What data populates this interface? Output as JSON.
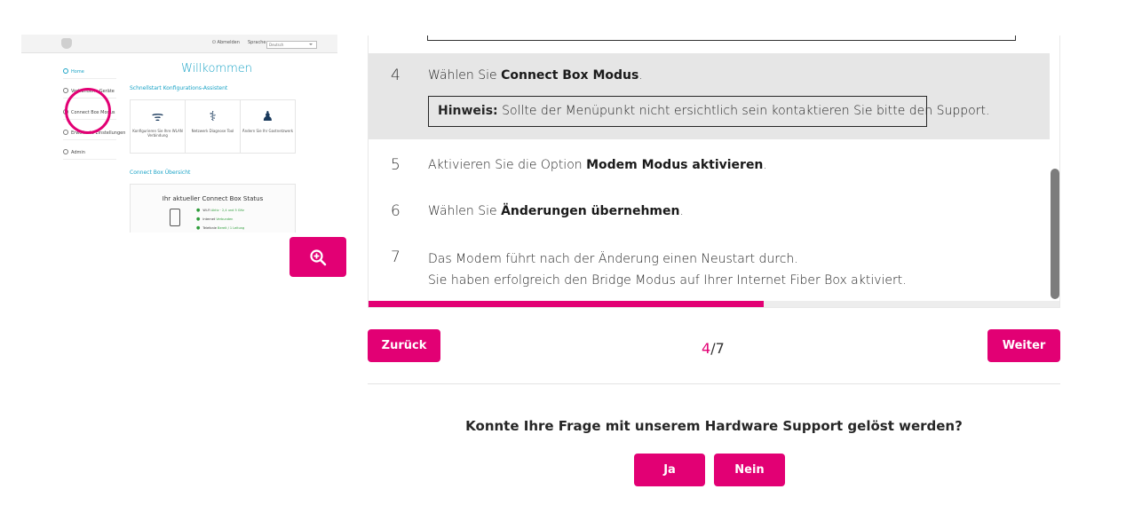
{
  "thumbnail": {
    "logout": "Abmelden",
    "language_label": "Sprache",
    "language_value": "Deutsch",
    "welcome": "Willkommen",
    "nav": [
      "Home",
      "Verbundene Geräte",
      "Connect Box Modus",
      "Erweiterte Einstellungen",
      "Admin"
    ],
    "quickstart": "Schnellstart Konfigurations-Assistent",
    "cards": [
      {
        "icon": "wifi-icon",
        "label": "Konfigurieren Sie Ihre WLAN Verbindung"
      },
      {
        "icon": "stethoscope-icon",
        "label": "Netzwerk Diagnose Tool"
      },
      {
        "icon": "guest-network-icon",
        "label": "Ändern Sie Ihr Gastnetzwerk"
      }
    ],
    "overview": "Connect Box Übersicht",
    "status_title": "Ihr aktueller Connect Box Status",
    "status_lines": [
      {
        "name": "Wi-Fi",
        "state": "Aktiv · 2,4 und 5 GHz"
      },
      {
        "name": "Internet",
        "state": "Verbunden"
      },
      {
        "name": "Telefonie",
        "state": "Bereit / 1 Leitung"
      }
    ]
  },
  "steps": [
    {
      "num": "4",
      "parts": [
        "Wählen Sie ",
        "Connect Box Modus",
        "."
      ],
      "hint_label": "Hinweis:",
      "hint_text": " Sollte der Menüpunkt nicht ersichtlich sein kontaktieren Sie bitte den Support."
    },
    {
      "num": "5",
      "parts": [
        "Aktivieren Sie die Option ",
        "Modem Modus aktivieren",
        "."
      ]
    },
    {
      "num": "6",
      "parts": [
        "Wählen Sie ",
        "Änderungen übernehmen",
        "."
      ]
    },
    {
      "num": "7",
      "line1": "Das Modem führt nach der Änderung einen Neustart durch.",
      "line2": "Sie haben erfolgreich den Bridge Modus auf Ihrer Internet Fiber Box aktiviert."
    }
  ],
  "progress": {
    "current": 4,
    "total": 7,
    "fraction": 0.571
  },
  "pager": {
    "current": "4",
    "separator": "/",
    "total": "7"
  },
  "buttons": {
    "back": "Zurück",
    "next": "Weiter",
    "yes": "Ja",
    "no": "Nein"
  },
  "feedback": {
    "question": "Konnte Ihre Frage mit unserem Hardware Support gelöst werden?"
  },
  "colors": {
    "accent": "#e20074",
    "highlight_row": "#e6e6e6",
    "router_ui_blue": "#1aa3c6"
  }
}
